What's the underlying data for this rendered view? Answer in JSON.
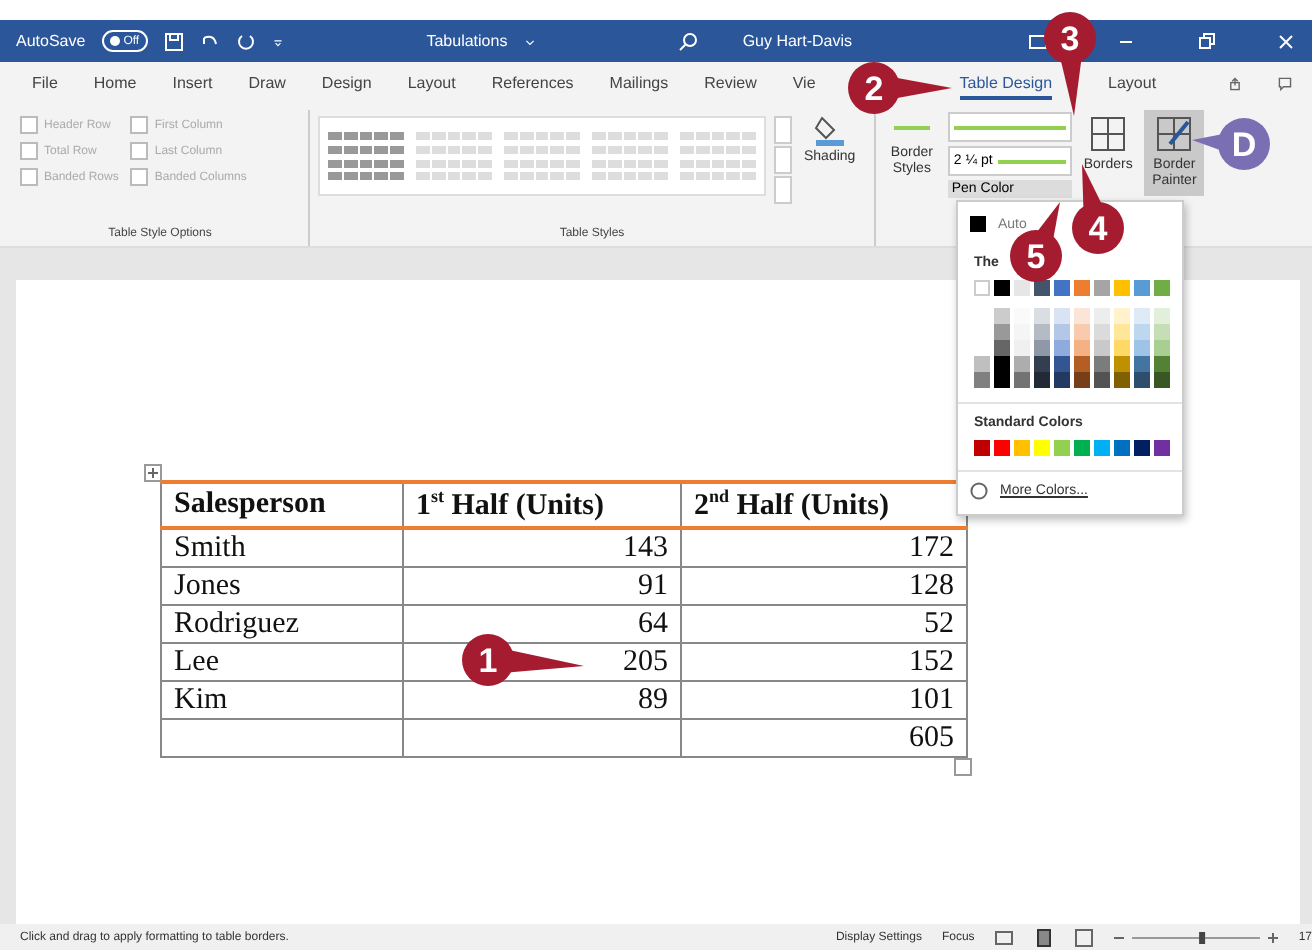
{
  "title_bar": {
    "autosave": {
      "label": "AutoSave",
      "state_text": "Off",
      "on": false
    },
    "document_title": "Tabulations",
    "user": "Guy Hart-Davis"
  },
  "menu_tabs": [
    {
      "label": "File",
      "selected": false
    },
    {
      "label": "Home",
      "selected": false
    },
    {
      "label": "Insert",
      "selected": false
    },
    {
      "label": "Draw",
      "selected": false
    },
    {
      "label": "Design",
      "selected": false
    },
    {
      "label": "Layout",
      "selected": false
    },
    {
      "label": "References",
      "selected": false
    },
    {
      "label": "Mailings",
      "selected": false
    },
    {
      "label": "Review",
      "selected": false
    },
    {
      "label": "Vie",
      "selected": false
    },
    {
      "label": "Table Design",
      "selected": true
    },
    {
      "label": "Layout",
      "selected": false
    }
  ],
  "ribbon": {
    "style_options": {
      "label": "Table Style Options",
      "checkboxes": [
        {
          "label": "Header Row",
          "checked": false,
          "disabled": true
        },
        {
          "label": "First Column",
          "checked": false,
          "disabled": true
        },
        {
          "label": "Total Row",
          "checked": false,
          "disabled": true
        },
        {
          "label": "Last Column",
          "checked": false,
          "disabled": true
        },
        {
          "label": "Banded Rows",
          "checked": false,
          "disabled": true
        },
        {
          "label": "Banded Columns",
          "checked": false,
          "disabled": true
        }
      ]
    },
    "table_styles": {
      "label": "Table Styles",
      "shading": "Shading"
    },
    "borders": {
      "border_styles": "Border Styles",
      "weight": "2 ¼ pt",
      "pen_color": "Pen Color",
      "borders": "Borders",
      "border_painter": {
        "label": "Border Painter",
        "selected": true
      }
    }
  },
  "color_menu": {
    "automatic": "Auto",
    "theme_heading": "The",
    "theme_colors": [
      {
        "color": "#ffffff"
      },
      {
        "color": "#000000"
      },
      {
        "color": "#e7e6e6"
      },
      {
        "color": "#44546a"
      },
      {
        "color": "#4472c4"
      },
      {
        "color": "#ed7d31"
      },
      {
        "color": "#a5a5a5"
      },
      {
        "color": "#ffc000"
      },
      {
        "color": "#5b9bd5"
      },
      {
        "color": "#70ad47"
      }
    ],
    "standard_heading": "Standard Colors",
    "standard_colors": [
      {
        "color": "#c00000"
      },
      {
        "color": "#ff0000"
      },
      {
        "color": "#ffc000"
      },
      {
        "color": "#ffff00"
      },
      {
        "color": "#92d050"
      },
      {
        "color": "#00b050"
      },
      {
        "color": "#00b0f0"
      },
      {
        "color": "#0070c0"
      },
      {
        "color": "#002060"
      },
      {
        "color": "#7030a0"
      }
    ],
    "more_colors": "More Colors..."
  },
  "table": {
    "columns": [
      "Salesperson",
      "1$^{st}$ Half (Units)",
      "2$^{nd}$ Half (Units)"
    ],
    "rows": [
      [
        "Smith",
        "143",
        "172"
      ],
      [
        "Jones",
        "91",
        "128"
      ],
      [
        "Rodriguez",
        "64",
        "52"
      ],
      [
        "Lee",
        "205",
        "152"
      ],
      [
        "Kim",
        "89",
        "101"
      ],
      [
        "",
        "",
        "605"
      ]
    ]
  },
  "status_bar": {
    "message": "Click and drag to apply formatting to table borders.",
    "display_settings": "Display Settings",
    "focus": "Focus",
    "zoom_slider": {
      "level": 0.55
    },
    "zoom": "17"
  },
  "callouts": [
    {
      "label": "1",
      "color": "#a51c30"
    },
    {
      "label": "2",
      "color": "#a51c30"
    },
    {
      "label": "3",
      "color": "#a51c30"
    },
    {
      "label": "4",
      "color": "#a51c30"
    },
    {
      "label": "5",
      "color": "#a51c30"
    },
    {
      "label": "D",
      "color": "#7b6fb3"
    }
  ]
}
